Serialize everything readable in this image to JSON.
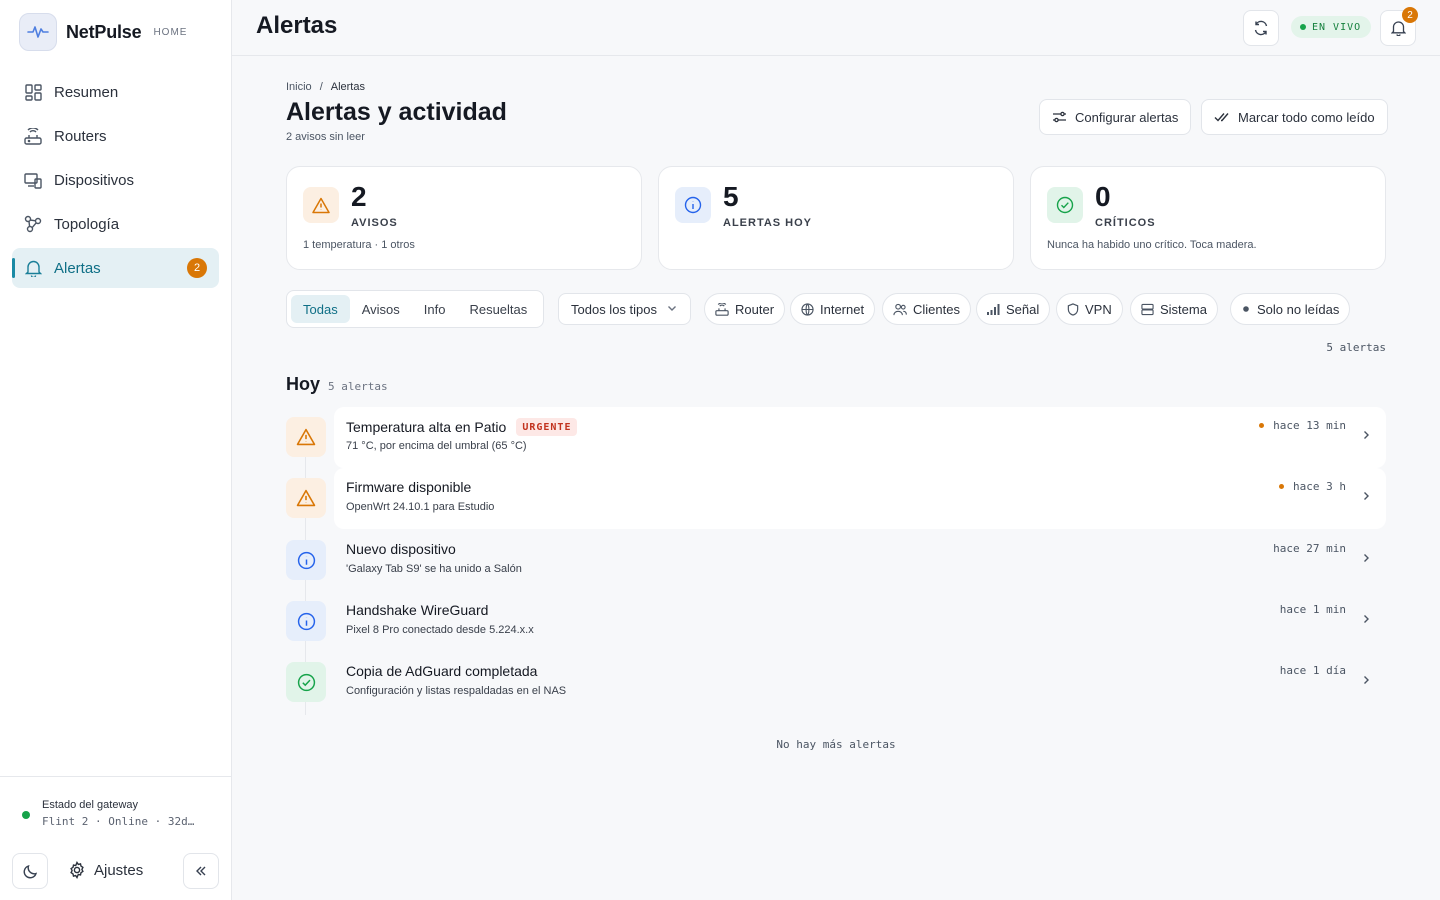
{
  "brand": {
    "name": "NetPulse",
    "tag": "HOME"
  },
  "nav": {
    "items": [
      {
        "label": "Resumen"
      },
      {
        "label": "Routers"
      },
      {
        "label": "Dispositivos"
      },
      {
        "label": "Topología"
      },
      {
        "label": "Alertas",
        "badge": "2"
      }
    ]
  },
  "gateway": {
    "title": "Estado del gateway",
    "status": "Flint 2 · Online · 32d…"
  },
  "footer": {
    "settings_label": "Ajustes"
  },
  "topbar": {
    "title": "Alertas",
    "live_label": "EN VIVO",
    "bell_badge": "2"
  },
  "breadcrumb": {
    "home": "Inicio",
    "sep": "/",
    "current": "Alertas"
  },
  "page": {
    "title": "Alertas y actividad",
    "subtitle": "2 avisos sin leer",
    "configure_label": "Configurar alertas",
    "mark_read_label": "Marcar todo como leído"
  },
  "stats": [
    {
      "value": "2",
      "label": "AVISOS",
      "note": "1 temperatura · 1 otros"
    },
    {
      "value": "5",
      "label": "ALERTAS HOY",
      "note": ""
    },
    {
      "value": "0",
      "label": "CRÍTICOS",
      "note": "Nunca ha habido uno crítico. Toca madera."
    }
  ],
  "filters": {
    "tabs": [
      "Todas",
      "Avisos",
      "Info",
      "Resueltas"
    ],
    "type_select": "Todos los tipos",
    "chips": [
      "Router",
      "Internet",
      "Clientes",
      "Señal",
      "VPN",
      "Sistema"
    ],
    "unread_only": "Solo no leídas",
    "count": "5 alertas"
  },
  "group": {
    "title": "Hoy",
    "count": "5 alertas"
  },
  "alerts": [
    {
      "title": "Temperatura alta en Patio",
      "tag": "URGENTE",
      "subtitle": "71 °C, por encima del umbral (65 °C)",
      "time": "hace 13 min",
      "unread": true,
      "icon": "warning-icon"
    },
    {
      "title": "Firmware disponible",
      "tag": "",
      "subtitle": "OpenWrt 24.10.1 para Estudio",
      "time": "hace 3 h",
      "unread": true,
      "icon": "warning-icon"
    },
    {
      "title": "Nuevo dispositivo",
      "tag": "",
      "subtitle": "'Galaxy Tab S9' se ha unido a Salón",
      "time": "hace 27 min",
      "unread": false,
      "icon": "info-icon"
    },
    {
      "title": "Handshake WireGuard",
      "tag": "",
      "subtitle": "Pixel 8 Pro conectado desde 5.224.x.x",
      "time": "hace 1 min",
      "unread": false,
      "icon": "info-icon"
    },
    {
      "title": "Copia de AdGuard completada",
      "tag": "",
      "subtitle": "Configuración y listas respaldadas en el NAS",
      "time": "hace 1 día",
      "unread": false,
      "icon": "check-circle-icon"
    }
  ],
  "end_note": "No hay más alertas",
  "colors": {
    "accent": "#1a8aa5",
    "warning": "#d97706",
    "info": "#2563eb",
    "success": "#16a34a",
    "urgent": "#c2331f"
  }
}
